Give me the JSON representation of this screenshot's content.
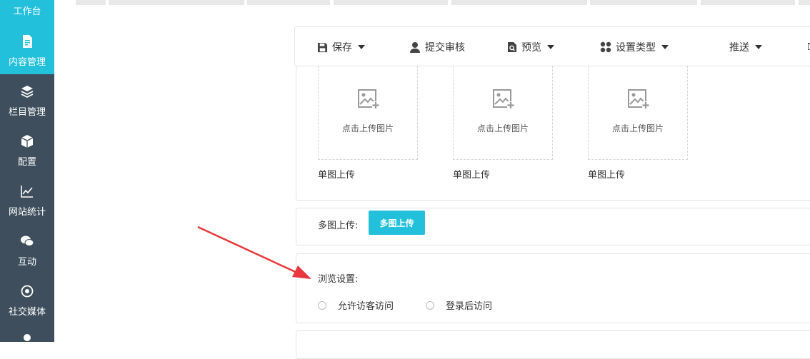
{
  "sidebar": {
    "top_label": "工作台",
    "items": [
      {
        "label": "内容管理",
        "icon": "document-icon",
        "active": true
      },
      {
        "label": "栏目管理",
        "icon": "layers-icon",
        "active": false
      },
      {
        "label": "配置",
        "icon": "cube-icon",
        "active": false
      },
      {
        "label": "网站统计",
        "icon": "chart-line-icon",
        "active": false
      },
      {
        "label": "互动",
        "icon": "chat-icon",
        "active": false
      },
      {
        "label": "社交媒体",
        "icon": "social-icon",
        "active": false
      }
    ]
  },
  "toolbar": {
    "save": "保存",
    "submit_review": "提交审核",
    "preview": "预览",
    "set_type": "设置类型",
    "push": "推送"
  },
  "upload": {
    "boxes": [
      {
        "text": "点击上传图片",
        "label": "单图上传"
      },
      {
        "text": "点击上传图片",
        "label": "单图上传"
      },
      {
        "text": "点击上传图片",
        "label": "单图上传"
      }
    ]
  },
  "multi_upload": {
    "label": "多图上传:",
    "button": "多图上传"
  },
  "browse": {
    "title": "浏览设置:",
    "options": [
      "允许访客访问",
      "登录后访问"
    ]
  },
  "colors": {
    "accent": "#22c0da",
    "sidebar_bg": "#3e4e5c",
    "arrow": "#e8383d"
  }
}
